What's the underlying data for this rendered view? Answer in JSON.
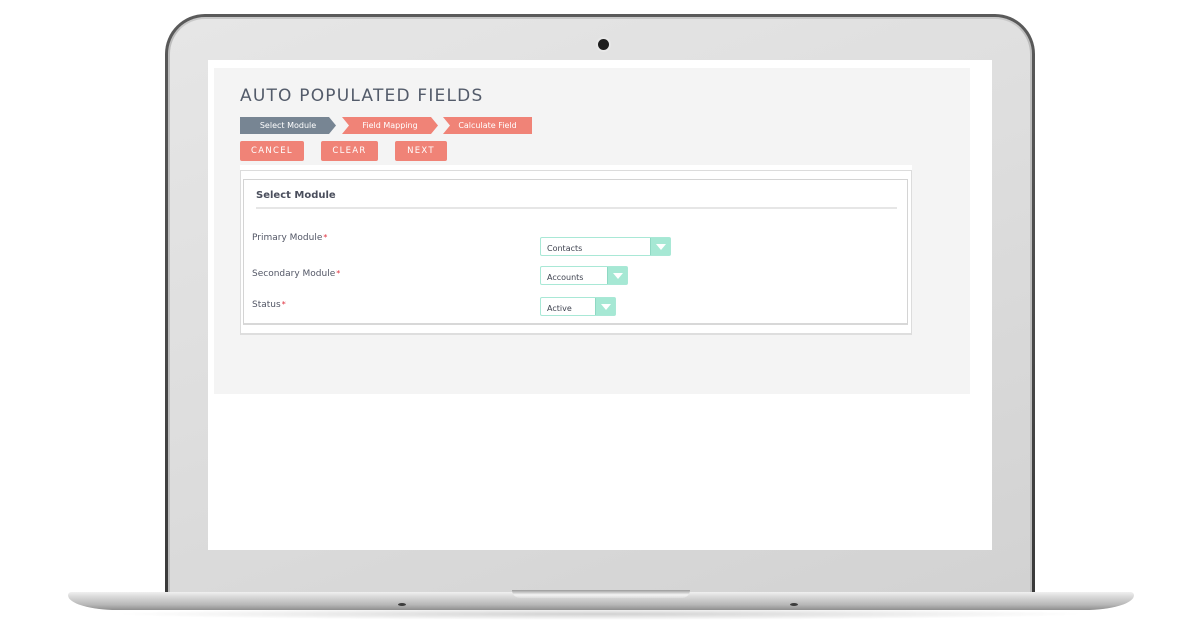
{
  "page": {
    "title": "AUTO POPULATED FIELDS"
  },
  "steps": [
    {
      "label": "Select Module",
      "state": "active",
      "color": "#778593"
    },
    {
      "label": "Field Mapping",
      "state": "pending",
      "color": "#f08377"
    },
    {
      "label": "Calculate Field",
      "state": "pending",
      "color": "#f08377"
    }
  ],
  "buttons": {
    "cancel": "CANCEL",
    "clear": "CLEAR",
    "next": "NEXT",
    "color": "#f08377"
  },
  "form": {
    "section_title": "Select Module",
    "required_marker": "*",
    "fields": [
      {
        "label": "Primary Module",
        "value": "Contacts",
        "icon": "chevron-down-icon"
      },
      {
        "label": "Secondary Module",
        "value": "Accounts",
        "icon": "chevron-down-icon"
      },
      {
        "label": "Status",
        "value": "Active",
        "icon": "chevron-down-icon"
      }
    ],
    "select_accent": "#a6e8d4"
  }
}
